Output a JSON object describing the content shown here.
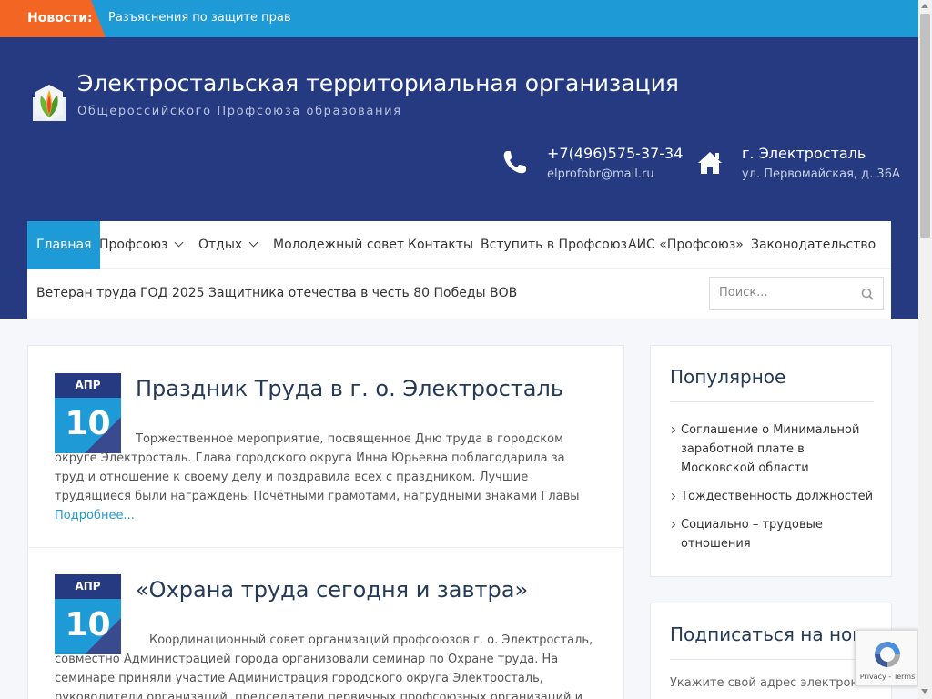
{
  "ticker": {
    "label": "Новости:",
    "text": "Разъяснения по защите прав"
  },
  "header": {
    "title": "Электростальская территориальная организация",
    "tagline": "Общероссийского Профсоюза образования",
    "phone": "+7(496)575-37-34",
    "email": "elprofobr@mail.ru",
    "city": "г. Электросталь",
    "address": "ул. Первомайская, д. 36А"
  },
  "nav": {
    "row1": [
      {
        "label": "Главная"
      },
      {
        "label": "Профсоюз"
      },
      {
        "label": "Отдых"
      },
      {
        "label": "Молодежный совет"
      },
      {
        "label": "Контакты"
      },
      {
        "label": "Вступить в Профсоюз"
      },
      {
        "label": "АИС «Профсоюз»"
      },
      {
        "label": "Законодательство"
      }
    ],
    "row2": [
      {
        "label": "Ветеран труда"
      },
      {
        "label": "ГОД 2025 Защитника отечества в честь 80 Победы ВОВ"
      }
    ],
    "search_placeholder": "Поиск..."
  },
  "posts": [
    {
      "month": "АПР",
      "day": "10",
      "title": "Праздник Труда в г. о. Электросталь",
      "excerpt": "Торжественное мероприятие, посвященное  Дню труда в городском округе Электросталь. Глава городского округа Инна Юрьевна поблагодарила за труд и отношение к своему делу и поздравила всех с праздником. Лучшие трудящиеся были награждены Почётными грамотами, нагрудными знаками Главы",
      "more": "Подробнее..."
    },
    {
      "month": "АПР",
      "day": "10",
      "title": "«Охрана труда сегодня и завтра»",
      "excerpt": "Координационный совет организаций профсоюзов г. о. Электросталь, совместно Администрацией города организовали семинар по Охране труда. На семинаре приняли участие Администрация городского округа Электросталь, руководители организаций, председатели первичных профсоюзных организаций и уполномоченные по"
    }
  ],
  "sidebar": {
    "popular_title": "Популярное",
    "popular": [
      "Соглашение о Минимальной заработной плате в Московской области",
      "Тождественность должностей",
      "Социально – трудовые отношения"
    ],
    "subscribe_title": "Подписаться на новости",
    "subscribe_text": "Укажите свой адрес электронной"
  },
  "recaptcha": {
    "links": "Privacy - Terms"
  },
  "colors": {
    "header_bg": "#253a80",
    "accent": "#1e9bd7",
    "ticker_label": "#f26522"
  }
}
